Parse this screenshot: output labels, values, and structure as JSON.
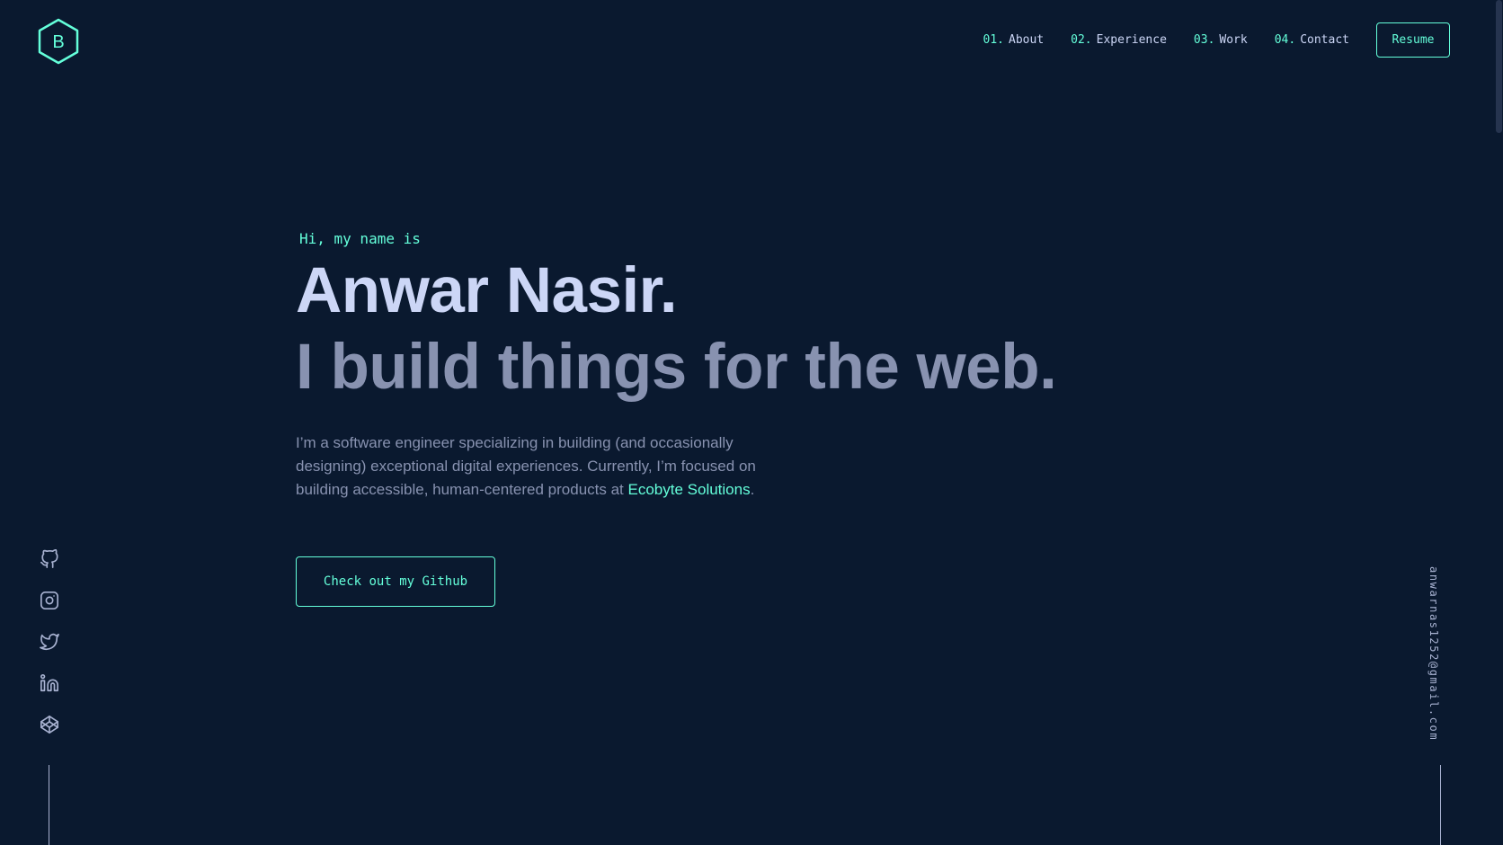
{
  "logo": {
    "letter": "B",
    "icon": "hexagon-logo-icon"
  },
  "nav": {
    "items": [
      {
        "num": "01.",
        "label": "About"
      },
      {
        "num": "02.",
        "label": "Experience"
      },
      {
        "num": "03.",
        "label": "Work"
      },
      {
        "num": "04.",
        "label": "Contact"
      }
    ],
    "resume_label": "Resume"
  },
  "hero": {
    "greeting": "Hi, my name is",
    "name": "Anwar Nasir.",
    "tagline": "I build things for the web.",
    "bio_prefix": "I’m a software engineer specializing in building (and occasionally designing) exceptional digital experiences. Currently, I’m focused on building accessible, human-centered products at ",
    "bio_link": "Ecobyte Solutions",
    "bio_suffix": ".",
    "cta_label": "Check out my Github"
  },
  "social": {
    "icons": [
      "github-icon",
      "instagram-icon",
      "twitter-icon",
      "linkedin-icon",
      "codepen-icon"
    ]
  },
  "email": "anwarnas1252@gmail.com",
  "colors": {
    "background": "#0a192f",
    "accent": "#64ffda",
    "heading": "#ccd6f6",
    "text": "#8892b0"
  }
}
